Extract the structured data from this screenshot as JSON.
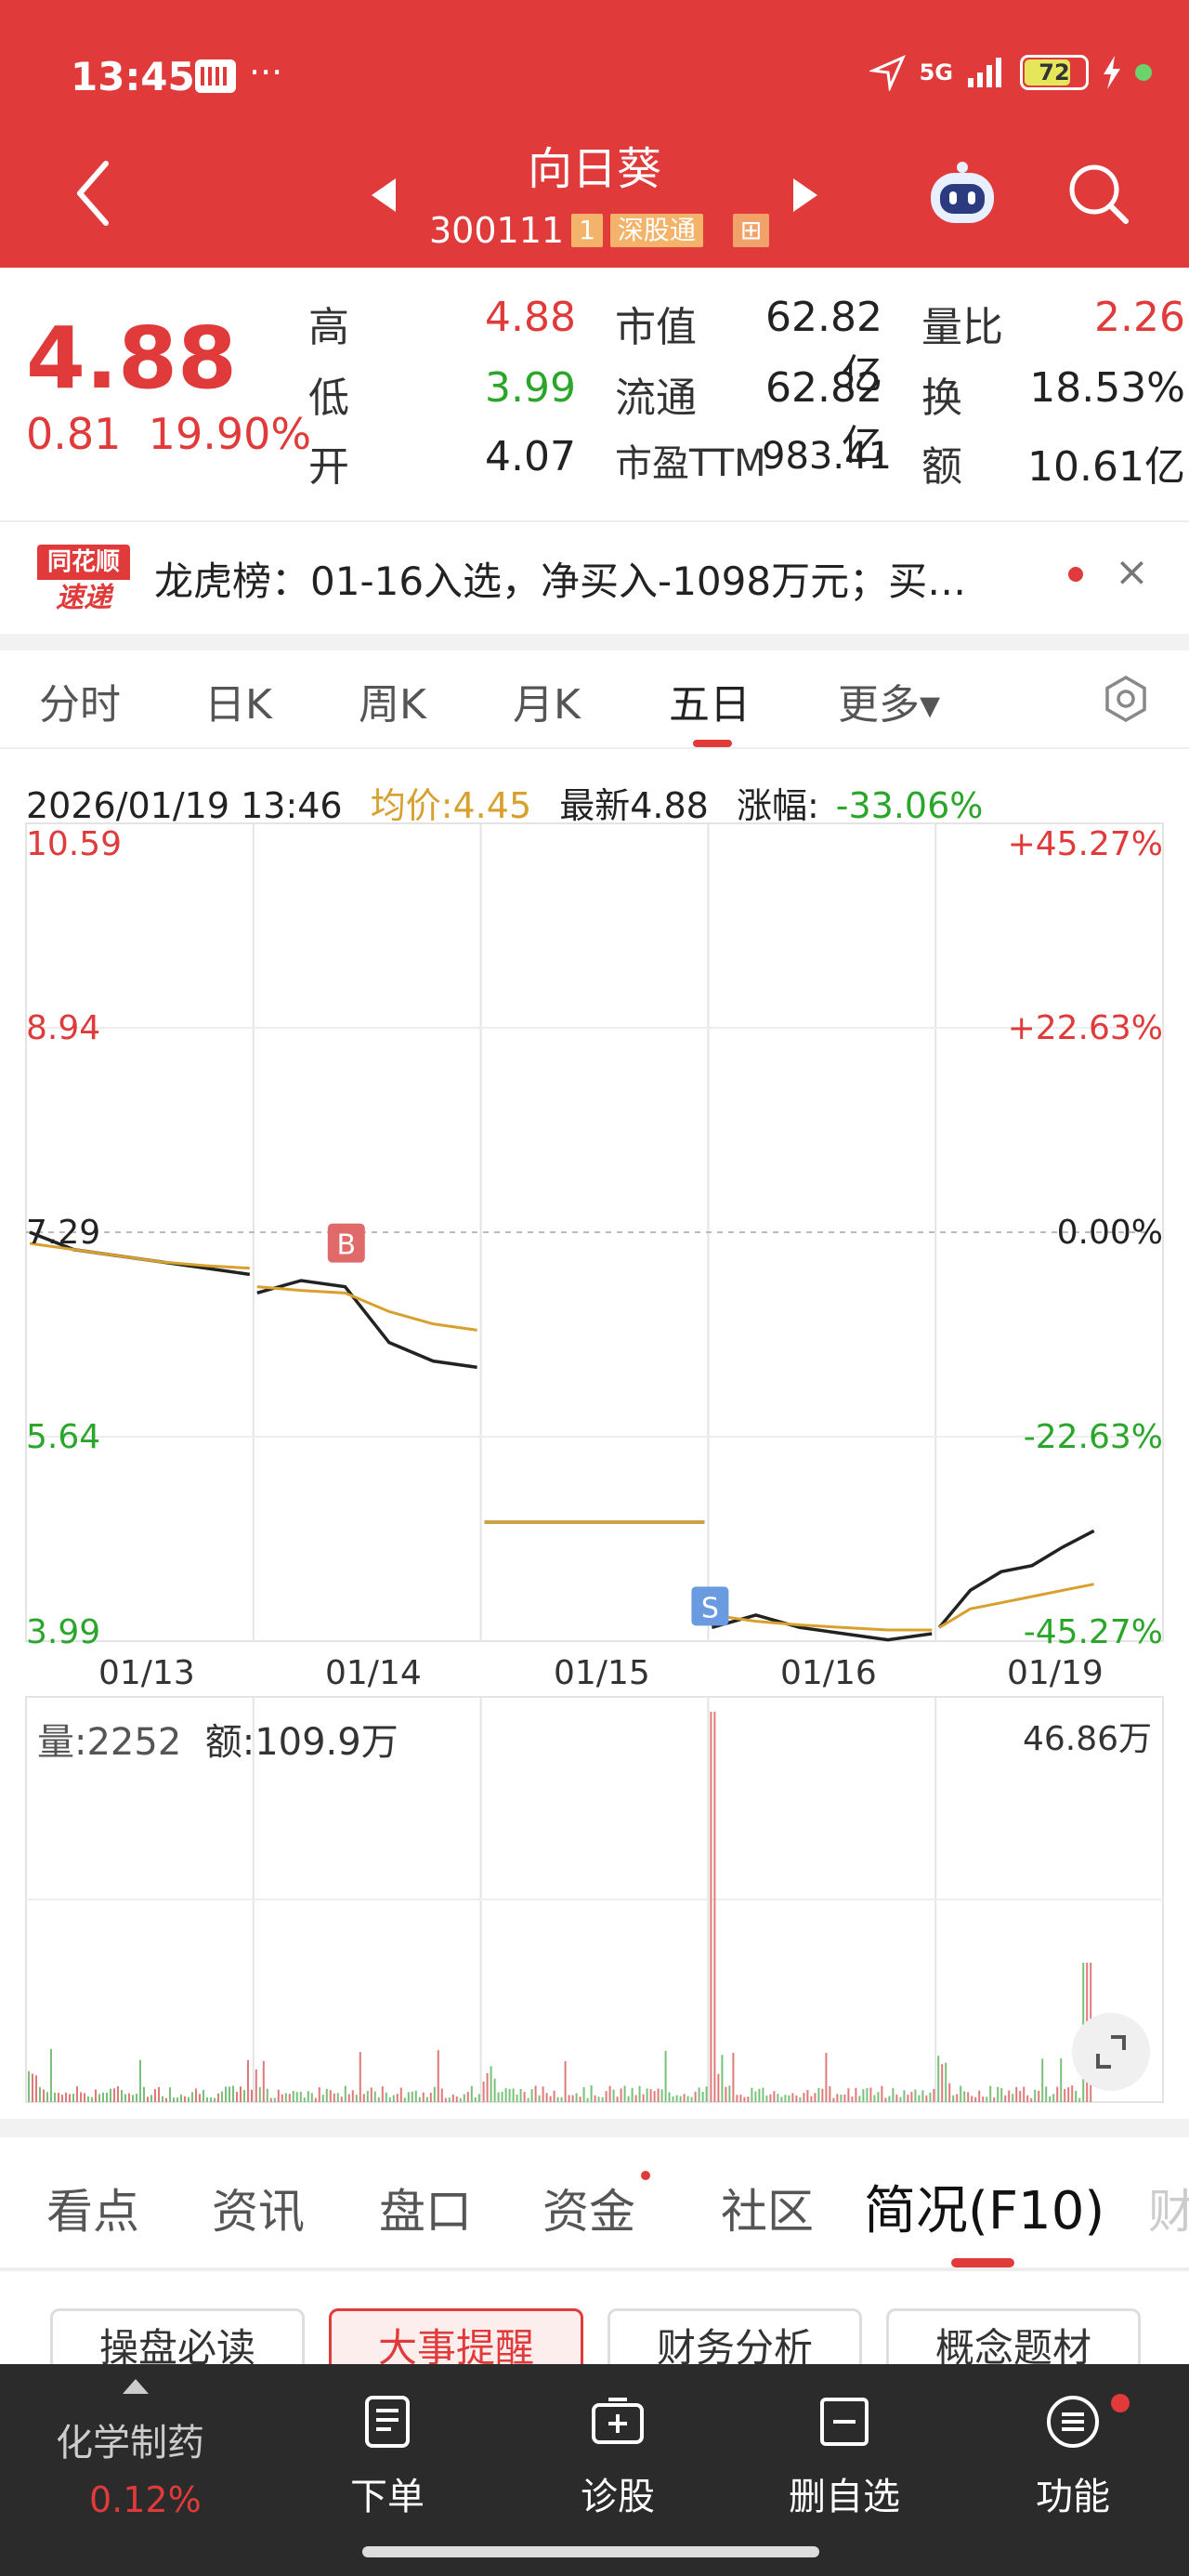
{
  "status": {
    "time": "13:45",
    "more": "···",
    "network": "5G",
    "battery": "72"
  },
  "header": {
    "title": "向日葵",
    "code": "300111",
    "tag_level": "1",
    "tag_connect": "深股通",
    "tag_extra": "⊞"
  },
  "quote": {
    "price": "4.88",
    "change": "0.81",
    "change_pct": "19.90%",
    "high_label": "高",
    "high": "4.88",
    "low_label": "低",
    "low": "3.99",
    "open_label": "开",
    "open": "4.07",
    "mcap_label": "市值",
    "mcap": "62.82亿",
    "float_label": "流通",
    "float": "62.82亿",
    "pe_label": "市盈TTM",
    "pe": "983.41",
    "vr_label": "量比",
    "vr": "2.26",
    "turn_label": "换",
    "turn": "18.53%",
    "amt_label": "额",
    "amt": "10.61亿"
  },
  "news": {
    "logo_top": "同花顺",
    "logo_bottom": "速递",
    "text": "龙虎榜：01-16入选，净买入-1098万元；买…",
    "close": "×"
  },
  "tabs": [
    {
      "label": "分时"
    },
    {
      "label": "日K"
    },
    {
      "label": "周K"
    },
    {
      "label": "月K"
    },
    {
      "label": "五日"
    },
    {
      "label": "更多▾"
    }
  ],
  "info": {
    "datetime": "2026/01/19 13:46",
    "avg": "均价:4.45",
    "latest": "最新4.88",
    "chg_label": "涨幅:",
    "chg": "-33.06%"
  },
  "chart_data": {
    "type": "line",
    "x": [
      "01/13",
      "01/14",
      "01/15",
      "01/16",
      "01/19"
    ],
    "y_left_ticks": [
      "10.59",
      "8.94",
      "7.29",
      "5.64",
      "3.99"
    ],
    "y_right_ticks": [
      "+45.27%",
      "+22.63%",
      "0.00%",
      "-22.63%",
      "-45.27%"
    ],
    "ylim": [
      3.99,
      10.59
    ],
    "base": 7.29,
    "series": [
      {
        "name": "",
        "segments": [
          [
            7.29,
            7.15,
            7.1,
            7.05,
            7.0,
            6.95
          ],
          [
            6.8,
            6.9,
            6.85,
            6.4,
            6.25,
            6.2
          ],
          [
            4.95,
            4.95,
            4.95,
            4.95,
            4.95,
            4.95
          ],
          [
            4.1,
            4.2,
            4.1,
            4.05,
            4.0,
            4.05
          ],
          [
            4.1,
            4.4,
            4.55,
            4.6,
            4.75,
            4.88
          ]
        ]
      },
      {
        "name": "",
        "segments": [
          [
            7.2,
            7.15,
            7.1,
            7.05,
            7.02,
            7.0
          ],
          [
            6.85,
            6.82,
            6.8,
            6.65,
            6.55,
            6.5
          ],
          [
            4.95,
            4.95,
            4.95,
            4.95,
            4.95,
            4.95
          ],
          [
            4.2,
            4.15,
            4.12,
            4.1,
            4.08,
            4.08
          ],
          [
            4.1,
            4.25,
            4.3,
            4.35,
            4.4,
            4.45
          ]
        ]
      }
    ],
    "markers": [
      {
        "label": "B",
        "day": 1,
        "value": 6.85
      },
      {
        "label": "S",
        "day": 3,
        "value": 4.1
      }
    ],
    "volume": {
      "vol_label": "量:2252",
      "amt_label": "额:109.9万",
      "max_label": "46.86万"
    }
  },
  "bottom_tabs": [
    {
      "label": "看点"
    },
    {
      "label": "资讯"
    },
    {
      "label": "盘口"
    },
    {
      "label": "资金"
    },
    {
      "label": "社区"
    },
    {
      "label": "简况(F10)"
    },
    {
      "label": "财"
    }
  ],
  "chips": [
    {
      "label": "操盘必读"
    },
    {
      "label": "大事提醒"
    },
    {
      "label": "财务分析"
    },
    {
      "label": "概念题材"
    }
  ],
  "bottom_nav": {
    "sector_name": "化学制药",
    "sector_pct": "0.12%",
    "items": [
      {
        "label": "下单"
      },
      {
        "label": "诊股"
      },
      {
        "label": "删自选"
      },
      {
        "label": "功能"
      }
    ]
  },
  "colors": {
    "brand_red": "#e03a3a",
    "up": "#e03a3a",
    "down": "#2aa62a",
    "avg_line": "#d8a02d"
  }
}
